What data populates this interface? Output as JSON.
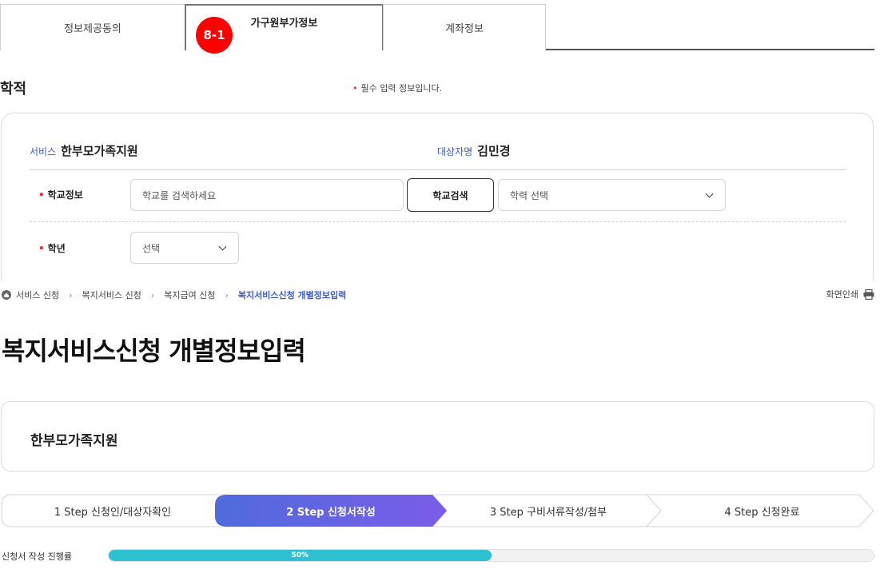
{
  "tabs": [
    {
      "label": "정보제공동의",
      "active": false
    },
    {
      "label": "가구원부가정보",
      "active": true,
      "badge": "8-1"
    },
    {
      "label": "계좌정보",
      "active": false
    }
  ],
  "school": {
    "title": "학적",
    "required_note": "필수 입력 정보입니다.",
    "service_label": "서비스",
    "service_value": "한부모가족지원",
    "target_label": "대상자명",
    "target_value": "김민경",
    "school_info_label": "학교정보",
    "school_input_placeholder": "학교를 검색하세요",
    "search_button": "학교검색",
    "education_select": "학력 선택",
    "grade_label": "학년",
    "grade_select": "선택"
  },
  "breadcrumb": [
    "서비스 신청",
    "복지서비스 신청",
    "복지급여 신청",
    "복지서비스신청 개별정보입력"
  ],
  "print_label": "화면인쇄",
  "page_title": "복지서비스신청 개별정보입력",
  "service_card_name": "한부모가족지원",
  "steps": [
    {
      "label": "1 Step 신청인/대상자확인",
      "active": false
    },
    {
      "label": "2 Step 신청서작성",
      "active": true
    },
    {
      "label": "3 Step 구비서류작성/첨부",
      "active": false
    },
    {
      "label": "4 Step 신청완료",
      "active": false
    }
  ],
  "progress": {
    "label": "신청서 작성 진행률",
    "percent": 50,
    "percent_text": "50%"
  },
  "colors": {
    "accent": "#3a5bd6",
    "step_active_start": "#4f6bdc",
    "step_active_end": "#7b5ce8",
    "progress": "#2fc1d2",
    "required": "#e5303b",
    "badge": "#ff0000"
  }
}
